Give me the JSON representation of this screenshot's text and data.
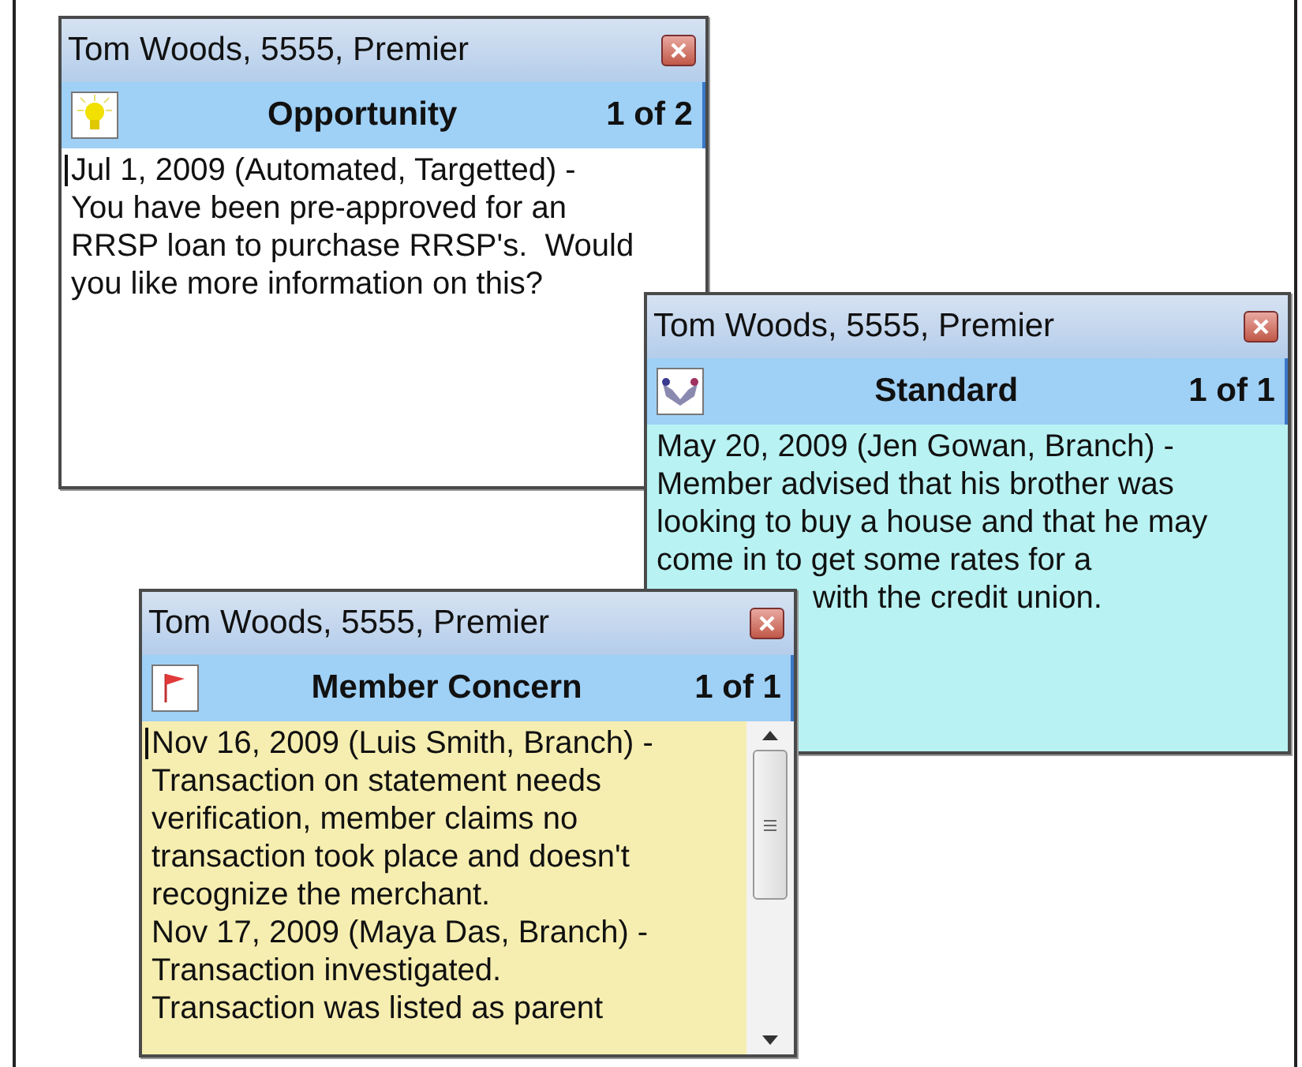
{
  "windows": [
    {
      "title": "Tom Woods, 5555, Premier",
      "type": "Opportunity",
      "count": "1 of 2",
      "color": "#ffffff",
      "caret": true,
      "scrollable": false,
      "lines": [
        "Jul 1, 2009 (Automated, Targetted) -",
        "You have been pre-approved for an",
        "RRSP loan to purchase RRSP's.  Would",
        "you like more information on this?"
      ]
    },
    {
      "title": "Tom Woods, 5555, Premier",
      "type": "Standard",
      "count": "1 of 1",
      "color": "#b9f2f2",
      "caret": false,
      "scrollable": false,
      "lines": [
        "May 20, 2009 (Jen Gowan, Branch) -",
        "Member advised that his brother was",
        "looking to buy a house and that he may",
        "come in to get some rates for a",
        "with the credit union."
      ]
    },
    {
      "title": "Tom Woods, 5555, Premier",
      "type": "Member Concern",
      "count": "1 of 1",
      "color": "#f6eeb0",
      "caret": true,
      "scrollable": true,
      "lines": [
        "Nov 16, 2009 (Luis Smith, Branch) -",
        "Transaction on statement needs",
        "verification, member claims no",
        "transaction took place and doesn't",
        "recognize the merchant.",
        "Nov 17, 2009 (Maya Das, Branch) -",
        "Transaction investigated.",
        "Transaction was listed as parent"
      ]
    }
  ]
}
